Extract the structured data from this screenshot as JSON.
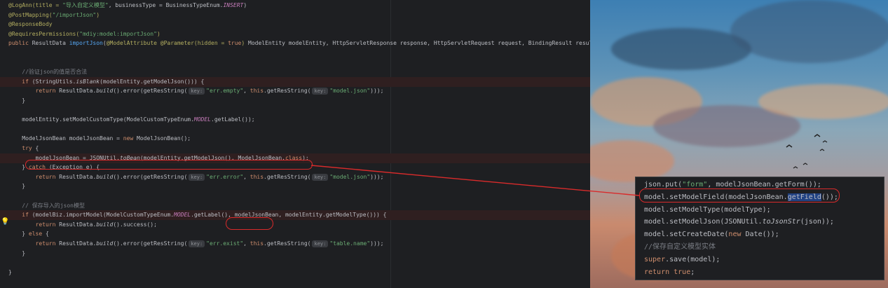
{
  "editor": {
    "lines": [
      {
        "tokens": [
          {
            "t": "@LogAnn(title = ",
            "c": "a"
          },
          {
            "t": "\"导入自定义模型\"",
            "c": "s"
          },
          {
            "t": ", businessType = BusinessTypeEnum."
          },
          {
            "t": "INSERT",
            "c": "f"
          },
          {
            "t": ")"
          }
        ]
      },
      {
        "tokens": [
          {
            "t": "@PostMapping(",
            "c": "a"
          },
          {
            "t": "\"/importJson\"",
            "c": "s"
          },
          {
            "t": ")",
            "c": "a"
          }
        ]
      },
      {
        "tokens": [
          {
            "t": "@ResponseBody",
            "c": "a"
          }
        ]
      },
      {
        "tokens": [
          {
            "t": "@RequiresPermissions(",
            "c": "a"
          },
          {
            "t": "\"mdiy:model:importJson\"",
            "c": "s"
          },
          {
            "t": ")",
            "c": "a"
          }
        ]
      },
      {
        "tokens": [
          {
            "t": "public ",
            "c": "k"
          },
          {
            "t": "ResultData "
          },
          {
            "t": "importJson",
            "c": "m"
          },
          {
            "t": "("
          },
          {
            "t": "@ModelAttribute @Parameter(hidden = ",
            "c": "a"
          },
          {
            "t": "true",
            "c": "k"
          },
          {
            "t": ") ",
            "c": "a"
          },
          {
            "t": "ModelEntity modelEntity, HttpServletResponse response, HttpServletRequest request, BindingResult result) {"
          }
        ]
      },
      {
        "tokens": []
      },
      {
        "tokens": []
      },
      {
        "tokens": [
          {
            "t": "    //验证json的值是否合法",
            "c": "c"
          }
        ]
      },
      {
        "tokens": [
          {
            "t": "    "
          },
          {
            "t": "if ",
            "c": "k"
          },
          {
            "t": "(StringUtils."
          },
          {
            "t": "isBlank",
            "c": "i"
          },
          {
            "t": "(modelEntity.getModelJson())) {"
          }
        ]
      },
      {
        "tokens": [
          {
            "t": "        "
          },
          {
            "t": "return ",
            "c": "k"
          },
          {
            "t": "ResultData."
          },
          {
            "t": "build",
            "c": "i"
          },
          {
            "t": "().error(getResString("
          },
          {
            "hint": "key:"
          },
          {
            "t": "\"err.empty\"",
            "c": "s"
          },
          {
            "t": ", "
          },
          {
            "t": "this",
            "c": "k"
          },
          {
            "t": ".getResString("
          },
          {
            "hint": "key:"
          },
          {
            "t": "\"model.json\"",
            "c": "s"
          },
          {
            "t": ")));"
          }
        ]
      },
      {
        "tokens": [
          {
            "t": "    }"
          }
        ]
      },
      {
        "tokens": []
      },
      {
        "tokens": [
          {
            "t": "    modelEntity.setModelCustomType(ModelCustomTypeEnum."
          },
          {
            "t": "MODEL",
            "c": "f"
          },
          {
            "t": ".getLabel());"
          }
        ]
      },
      {
        "tokens": []
      },
      {
        "tokens": [
          {
            "t": "    ModelJsonBean modelJsonBean = "
          },
          {
            "t": "new ",
            "c": "k"
          },
          {
            "t": "ModelJsonBean();"
          }
        ]
      },
      {
        "tokens": [
          {
            "t": "    "
          },
          {
            "t": "try ",
            "c": "k"
          },
          {
            "t": "{"
          }
        ]
      },
      {
        "tokens": [
          {
            "t": "        modelJsonBean = JSONUtil."
          },
          {
            "t": "toBean",
            "c": "i"
          },
          {
            "t": "(modelEntity.getModelJson(), ModelJsonBean."
          },
          {
            "t": "class",
            "c": "k"
          },
          {
            "t": ");"
          }
        ]
      },
      {
        "tokens": [
          {
            "t": "    } "
          },
          {
            "t": "catch ",
            "c": "k"
          },
          {
            "t": "(Exception e) {"
          }
        ]
      },
      {
        "tokens": [
          {
            "t": "        "
          },
          {
            "t": "return ",
            "c": "k"
          },
          {
            "t": "ResultData."
          },
          {
            "t": "build",
            "c": "i"
          },
          {
            "t": "().error(getResString("
          },
          {
            "hint": "key:"
          },
          {
            "t": "\"err.error\"",
            "c": "s"
          },
          {
            "t": ", "
          },
          {
            "t": "this",
            "c": "k"
          },
          {
            "t": ".getResString("
          },
          {
            "hint": "key:"
          },
          {
            "t": "\"model.json\"",
            "c": "s"
          },
          {
            "t": ")));"
          }
        ]
      },
      {
        "tokens": [
          {
            "t": "    }"
          }
        ]
      },
      {
        "tokens": []
      },
      {
        "tokens": [
          {
            "t": "    // 保存导入的json模型",
            "c": "c"
          }
        ]
      },
      {
        "tokens": [
          {
            "t": "    "
          },
          {
            "t": "if ",
            "c": "k"
          },
          {
            "t": "(modelBiz.importModel(ModelCustomTypeEnum."
          },
          {
            "t": "MODEL",
            "c": "f"
          },
          {
            "t": ".getLabel(), modelJsonBean, modelEntity.getModelType())) {"
          }
        ]
      },
      {
        "tokens": [
          {
            "t": "        "
          },
          {
            "t": "return ",
            "c": "k"
          },
          {
            "t": "ResultData."
          },
          {
            "t": "build",
            "c": "i"
          },
          {
            "t": "().success();"
          }
        ]
      },
      {
        "tokens": [
          {
            "t": "    } "
          },
          {
            "t": "else ",
            "c": "k"
          },
          {
            "t": "{"
          }
        ]
      },
      {
        "tokens": [
          {
            "t": "        "
          },
          {
            "t": "return ",
            "c": "k"
          },
          {
            "t": "ResultData."
          },
          {
            "t": "build",
            "c": "i"
          },
          {
            "t": "().error(getResString("
          },
          {
            "hint": "key:"
          },
          {
            "t": "\"err.exist\"",
            "c": "s"
          },
          {
            "t": ", "
          },
          {
            "t": "this",
            "c": "k"
          },
          {
            "t": ".getResString("
          },
          {
            "hint": "key:"
          },
          {
            "t": "\"table.name\"",
            "c": "s"
          },
          {
            "t": ")));"
          }
        ]
      },
      {
        "tokens": [
          {
            "t": "    }"
          }
        ]
      },
      {
        "tokens": []
      },
      {
        "tokens": [
          {
            "t": "}"
          }
        ]
      }
    ]
  },
  "popup": {
    "lines": [
      {
        "tokens": [
          {
            "t": "json.put("
          },
          {
            "t": "\"form\"",
            "c": "s"
          },
          {
            "t": ", modelJsonBean.getForm());"
          }
        ]
      },
      {
        "tokens": [
          {
            "t": "model.setModelField(modelJsonBean."
          },
          {
            "t": "getField",
            "sel": true
          },
          {
            "t": "());"
          }
        ]
      },
      {
        "tokens": [
          {
            "t": "model.setModelType(modelType);"
          }
        ]
      },
      {
        "tokens": [
          {
            "t": "model.setModelJson(JSONUtil."
          },
          {
            "t": "toJsonStr",
            "c": "i"
          },
          {
            "t": "(json));"
          }
        ]
      },
      {
        "tokens": [
          {
            "t": "model.setCreateDate("
          },
          {
            "t": "new ",
            "c": "k"
          },
          {
            "t": "Date());"
          }
        ]
      },
      {
        "tokens": [
          {
            "t": "//保存自定义模型实体",
            "c": "c"
          }
        ]
      },
      {
        "tokens": [
          {
            "t": "super",
            "c": "k"
          },
          {
            "t": ".save(model);"
          }
        ]
      },
      {
        "tokens": [
          {
            "t": "return true",
            "c": "k"
          },
          {
            "t": ";"
          }
        ]
      }
    ]
  },
  "colors": {
    "annotation": "#d92b2b",
    "keyword": "#cf8e6d",
    "string": "#6aab73",
    "annotation_tag": "#b3ae60",
    "selection": "#214283"
  },
  "icons": {
    "gutter": "lightbulb-icon"
  }
}
